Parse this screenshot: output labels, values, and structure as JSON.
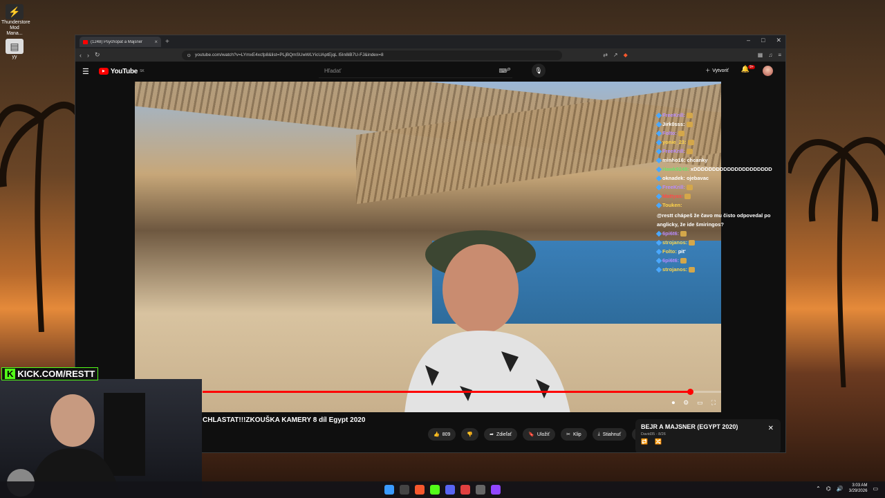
{
  "desktop": {
    "icons": [
      {
        "label": "Thunderstore Mod Mana...",
        "icon": "thunderstore-icon"
      },
      {
        "label": "yy",
        "icon": "file-icon"
      }
    ]
  },
  "browser": {
    "tab_title": "(1248) Psychopat a Majsner",
    "tab_close": "×",
    "new_tab": "+",
    "window_controls": [
      "–",
      "□",
      "✕"
    ],
    "url": "youtube.com/watch?v=LYmxE4xcfp8&list=PLjBQmSUwWLYicUAptEjqL I5In8iB7U-FJ&index=8"
  },
  "youtube": {
    "logo": "YouTube",
    "country": "SK",
    "search_placeholder": "Hľadať",
    "create_label": "Vytvoriť",
    "notification_count": "9+"
  },
  "video": {
    "title": "CHLASTAT!!!ZKOUŠKA KAMERY 8 díl Egypt 2020",
    "progress": 0.94,
    "actions": {
      "likes": "809",
      "share": "Zdieľať",
      "save": "Uložiť",
      "clip": "Klip",
      "download": "Stiahnuť",
      "more": "···"
    }
  },
  "playlist": {
    "title": "BEJR A MAJSNER (EGYPT 2020)",
    "subtitle": "David35 - 8/26"
  },
  "chat": [
    {
      "name": "FreeKrill:",
      "color": "purple",
      "msg": "",
      "emote": true
    },
    {
      "name": "Jirk0sss:",
      "color": "white",
      "msg": "",
      "emote": true
    },
    {
      "name": "Folto:",
      "color": "purple",
      "msg": "",
      "emote": true
    },
    {
      "name": "yonie_23:",
      "color": "yellow",
      "msg": "",
      "emote": true
    },
    {
      "name": "FreeKrill:",
      "color": "purple",
      "msg": "",
      "emote": true
    },
    {
      "name": "minho16:",
      "color": "white",
      "msg": "chcanky",
      "emote": false
    },
    {
      "name": "Hawk9248:",
      "color": "green",
      "msg": "xDDDDDDDDDDDDDDDDDDDDD",
      "emote": false
    },
    {
      "name": "oknadek:",
      "color": "white",
      "msg": "ojebavac",
      "emote": false
    },
    {
      "name": "FreeKrill:",
      "color": "purple",
      "msg": "",
      "emote": true
    },
    {
      "name": "Mattyas:",
      "color": "red",
      "msg": "",
      "emote": true
    },
    {
      "name": "Touken:",
      "color": "yellow",
      "msg": "@restt chápeš že čavo mu čisto odpovedal po anglicky, že ide šmiringos?",
      "emote": false
    },
    {
      "name": "6pi6t6:",
      "color": "purple",
      "msg": "",
      "emote": true
    },
    {
      "name": "strojanos:",
      "color": "yellow",
      "msg": "",
      "emote": true
    },
    {
      "name": "Folto:",
      "color": "yellow",
      "msg": "pit'",
      "emote": false
    },
    {
      "name": "6pi6t6:",
      "color": "purple",
      "msg": "",
      "emote": true
    },
    {
      "name": "strojanos:",
      "color": "yellow",
      "msg": "",
      "emote": true
    }
  ],
  "webcam": {
    "kick_label": "KICK.COM/RESTT"
  },
  "taskbar": {
    "time": "3:03 AM",
    "date": "3/29/2026"
  }
}
